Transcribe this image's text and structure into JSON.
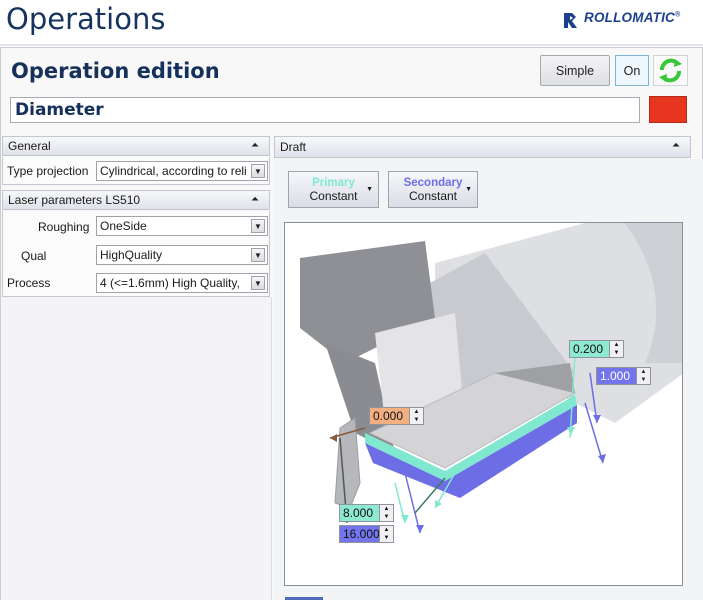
{
  "header": {
    "title": "Operations",
    "brand": "ROLLOMATIC",
    "brand_mark": "®"
  },
  "operation": {
    "section_title": "Operation edition",
    "simple_label": "Simple",
    "on_label": "On",
    "name_value": "Diameter",
    "color": "#e7361f"
  },
  "general": {
    "header": "General",
    "type_projection_label": "Type projection",
    "type_projection_value": "Cylindrical, according to reli"
  },
  "laser": {
    "header": "Laser parameters LS510",
    "roughing_label": "Roughing",
    "roughing_value": "OneSide",
    "qual_label": "Qual",
    "qual_value": "HighQuality",
    "process_label": "Process",
    "process_value": "4   (<=1.6mm) High Quality, "
  },
  "draft": {
    "header": "Draft",
    "primary_top": "Primary",
    "primary_bottom": "Constant",
    "secondary_top": "Secondary",
    "secondary_bottom": "Constant"
  },
  "spinners": {
    "top_offset": "0.200",
    "side_offset": "1.000",
    "angle": "0.000",
    "depth_primary": "8.000",
    "depth_secondary": "16.000"
  },
  "colors": {
    "primary_accent": "#7fe8cf",
    "secondary_accent": "#6d6ee6",
    "angle_accent": "#f2b080"
  },
  "icons": {
    "collapse": "double-chevron-up-icon",
    "dropdown": "triangle-down-icon",
    "refresh": "refresh-icon"
  }
}
